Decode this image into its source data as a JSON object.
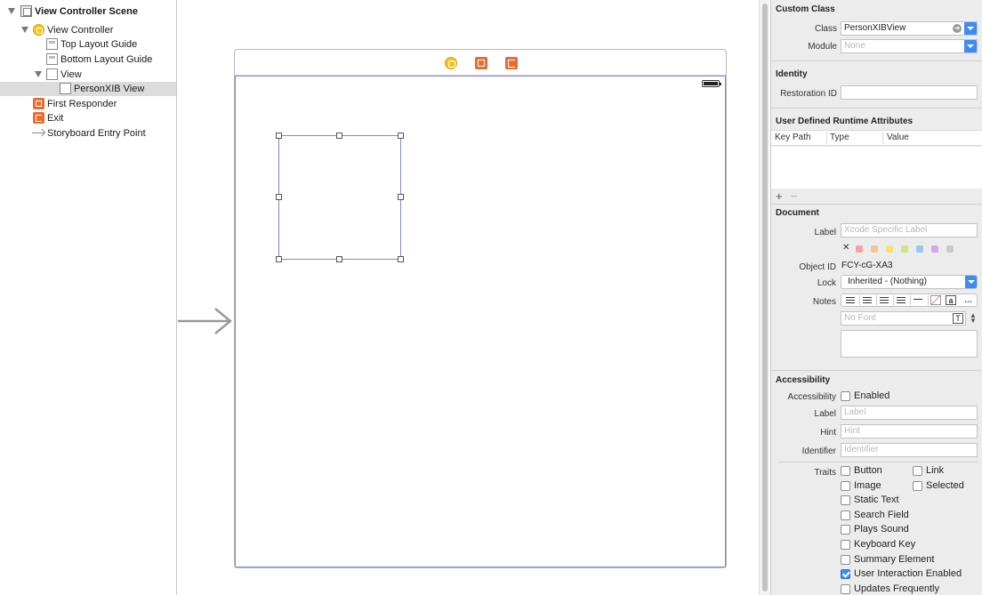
{
  "outline": {
    "items": [
      {
        "label": "View Controller Scene"
      },
      {
        "label": "View Controller"
      },
      {
        "label": "Top Layout Guide"
      },
      {
        "label": "Bottom Layout Guide"
      },
      {
        "label": "View"
      },
      {
        "label": "PersonXIB View"
      },
      {
        "label": "First Responder"
      },
      {
        "label": "Exit"
      },
      {
        "label": "Storyboard Entry Point"
      }
    ]
  },
  "inspector": {
    "custom_class": {
      "title": "Custom Class",
      "class_label": "Class",
      "class_value": "PersonXIBView",
      "module_label": "Module",
      "module_placeholder": "None"
    },
    "identity": {
      "title": "Identity",
      "restoration_label": "Restoration ID",
      "restoration_value": ""
    },
    "runtime_attributes": {
      "title": "User Defined Runtime Attributes",
      "columns": [
        "Key Path",
        "Type",
        "Value"
      ],
      "add": "+",
      "remove": "−"
    },
    "document": {
      "title": "Document",
      "label_label": "Label",
      "label_placeholder": "Xcode Specific Label",
      "clear_glyph": "✕",
      "swatch_colors": [
        "#f4a4a0",
        "#f6c597",
        "#f3e27b",
        "#c8e88a",
        "#9cc5f2",
        "#d5a9e8",
        "#c9c9c9"
      ],
      "object_id_label": "Object ID",
      "object_id_value": "FCY-cG-XA3",
      "lock_label": "Lock",
      "lock_value": "Inherited - (Nothing)",
      "notes_label": "Notes",
      "notes_font_placeholder": "No Font",
      "more_glyph": "…",
      "font_glyph": "T",
      "image_glyph": "a"
    },
    "accessibility": {
      "title": "Accessibility",
      "accessibility_label": "Accessibility",
      "enabled_label": "Enabled",
      "enabled": false,
      "label_label": "Label",
      "label_placeholder": "Label",
      "hint_label": "Hint",
      "hint_placeholder": "Hint",
      "identifier_label": "Identifier",
      "identifier_placeholder": "Identifier",
      "traits_label": "Traits",
      "traits_left": [
        {
          "label": "Button",
          "checked": false
        },
        {
          "label": "Image",
          "checked": false
        },
        {
          "label": "Static Text",
          "checked": false
        },
        {
          "label": "Search Field",
          "checked": false
        },
        {
          "label": "Plays Sound",
          "checked": false
        },
        {
          "label": "Keyboard Key",
          "checked": false
        },
        {
          "label": "Summary Element",
          "checked": false
        },
        {
          "label": "User Interaction Enabled",
          "checked": true
        },
        {
          "label": "Updates Frequently",
          "checked": false
        }
      ],
      "traits_right": [
        {
          "label": "Link",
          "checked": false
        },
        {
          "label": "Selected",
          "checked": false
        }
      ]
    }
  },
  "colors": {
    "selection_border": "#7f87d8",
    "vc_icon": "#f5c518",
    "object_icon": "#ec6b2d",
    "popup_accent": "#3d8cf2"
  },
  "icons": {
    "scene": "scene-icon",
    "view_controller": "view-controller-icon",
    "layout_guide": "layout-guide-icon",
    "view": "view-icon",
    "first_responder": "first-responder-icon",
    "exit": "exit-icon",
    "entry_point": "entry-arrow-icon",
    "battery": "battery-icon"
  }
}
